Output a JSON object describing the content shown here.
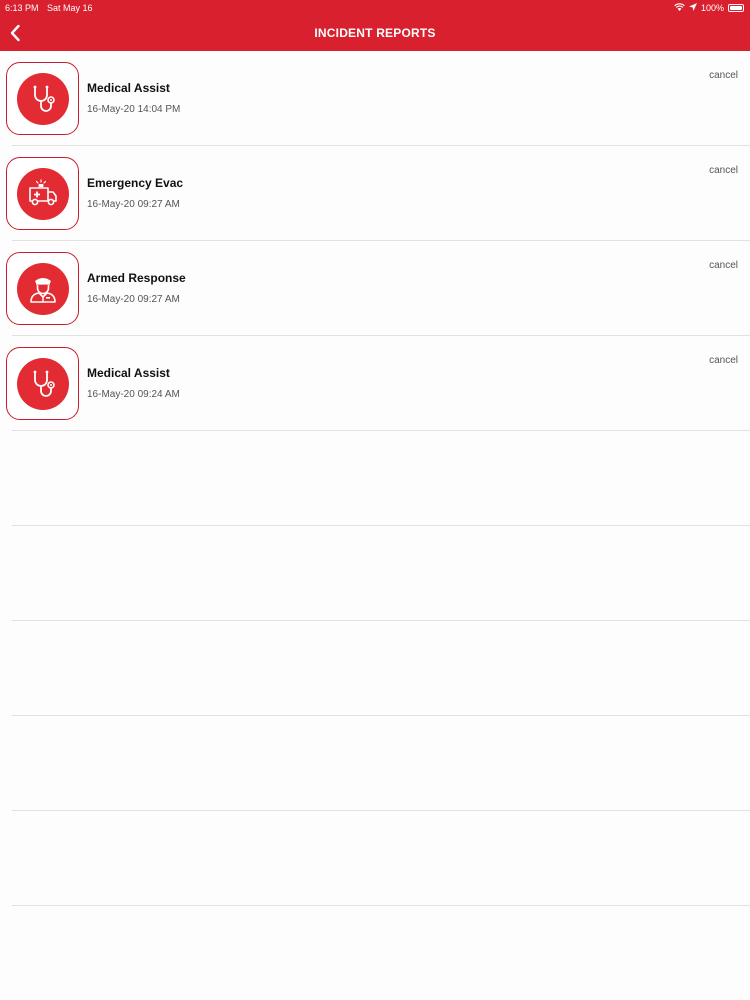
{
  "status_bar": {
    "time": "6:13 PM",
    "date": "Sat May 16",
    "battery": "100%",
    "wifi_icon": "wifi-icon",
    "location_icon": "location-arrow-icon",
    "battery_icon": "battery-icon"
  },
  "header": {
    "title": "INCIDENT REPORTS",
    "back_icon": "chevron-left-icon",
    "background": "#d9202f"
  },
  "reports": [
    {
      "title": "Medical Assist",
      "date": "16-May-20 14:04 PM",
      "action": "cancel",
      "icon": "stethoscope-icon"
    },
    {
      "title": "Emergency Evac",
      "date": "16-May-20 09:27 AM",
      "action": "cancel",
      "icon": "ambulance-icon"
    },
    {
      "title": "Armed Response",
      "date": "16-May-20 09:27 AM",
      "action": "cancel",
      "icon": "security-guard-icon"
    },
    {
      "title": "Medical Assist",
      "date": "16-May-20 09:24 AM",
      "action": "cancel",
      "icon": "stethoscope-icon"
    }
  ],
  "colors": {
    "accent": "#d9202f",
    "icon_circle": "#e32b33",
    "icon_border": "#c81e2c"
  }
}
